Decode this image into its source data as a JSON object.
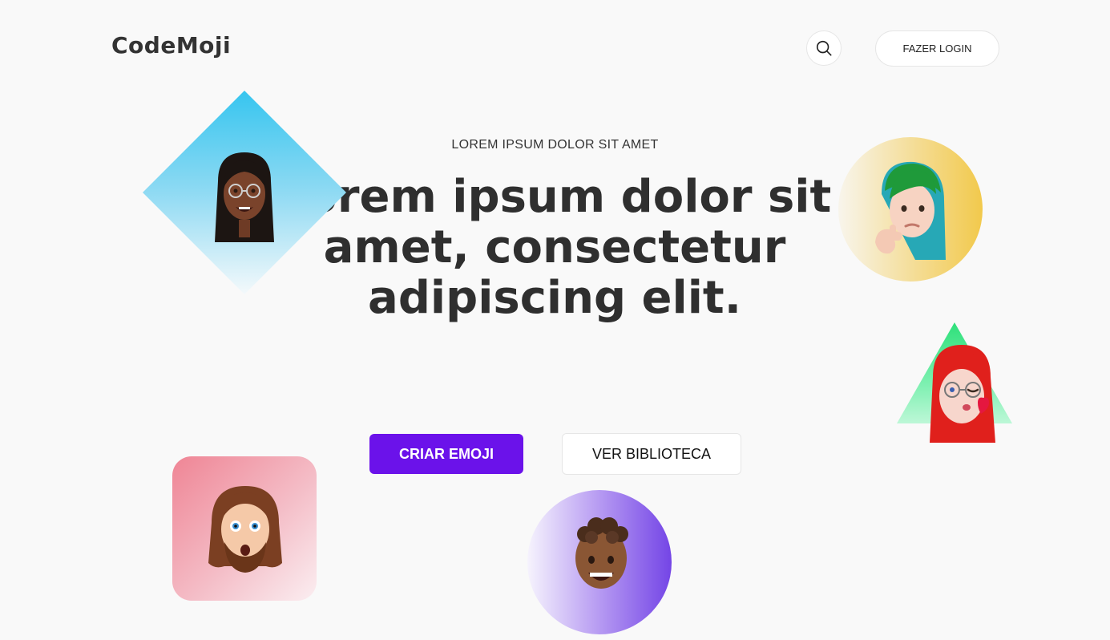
{
  "header": {
    "logo": "CodeMoji",
    "search_icon": "search-icon",
    "login_label": "FAZER LOGIN"
  },
  "hero": {
    "eyebrow": "LOREM IPSUM DOLOR SIT AMET",
    "headline": "Lorem ipsum dolor sit amet, consectetur adipiscing elit.",
    "primary_button": "CRIAR EMOJI",
    "secondary_button": "VER BIBLIOTECA"
  },
  "colors": {
    "accent": "#6b12ea",
    "background": "#f9f9f9",
    "text": "#333333"
  },
  "decorations": [
    {
      "shape": "diamond",
      "color": "#36c5ef",
      "avatar": "woman-with-glasses-avatar"
    },
    {
      "shape": "circle",
      "color": "#f2c94c",
      "avatar": "thinking-woman-avatar"
    },
    {
      "shape": "triangle",
      "color": "#2ee07a",
      "avatar": "kissing-woman-avatar"
    },
    {
      "shape": "rounded-square",
      "color": "#ef8595",
      "avatar": "shocked-man-avatar"
    },
    {
      "shape": "circle",
      "color": "#7445e6",
      "avatar": "smiling-man-avatar"
    }
  ]
}
